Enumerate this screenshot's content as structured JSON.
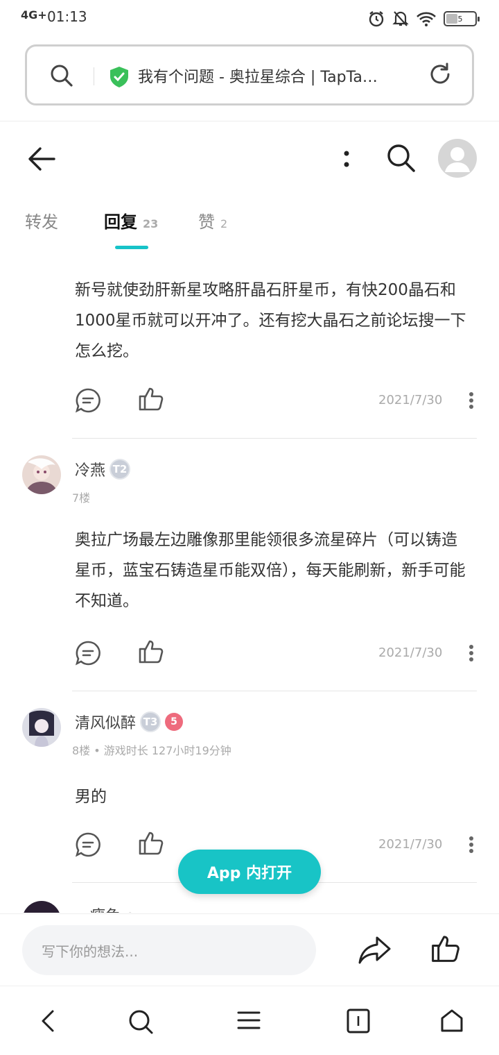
{
  "status_bar": {
    "network": "4G+",
    "time": "01:13",
    "battery": "5"
  },
  "address_bar": {
    "url_title": "我有个问题 - 奥拉星综合 | TapTa…"
  },
  "tabs": [
    {
      "label": "转发",
      "count": ""
    },
    {
      "label": "回复",
      "count": "23"
    },
    {
      "label": "赞",
      "count": "2"
    }
  ],
  "posts": [
    {
      "body": "新号就使劲肝新星攻略肝晶石肝星币，有快200晶石和1000星币就可以开冲了。还有挖大晶石之前论坛搜一下怎么挖。",
      "date": "2021/7/30"
    },
    {
      "author": "冷燕",
      "badge": "T2",
      "meta": "7楼",
      "body": "奥拉广场最左边雕像那里能领很多流星碎片（可以铸造星币，蓝宝石铸造星币能双倍），每天能刷新，新手可能不知道。",
      "date": "2021/7/30"
    },
    {
      "author": "清风似醉",
      "badge": "T3",
      "badge2": "5",
      "meta": "8楼 • 游戏时长 127小时19分钟",
      "body": "男的",
      "date": "2021/7/30"
    },
    {
      "author": "…瘦兔 ou…"
    }
  ],
  "open_app_button": "App 内打开",
  "comment_input": {
    "placeholder": "写下你的想法..."
  }
}
